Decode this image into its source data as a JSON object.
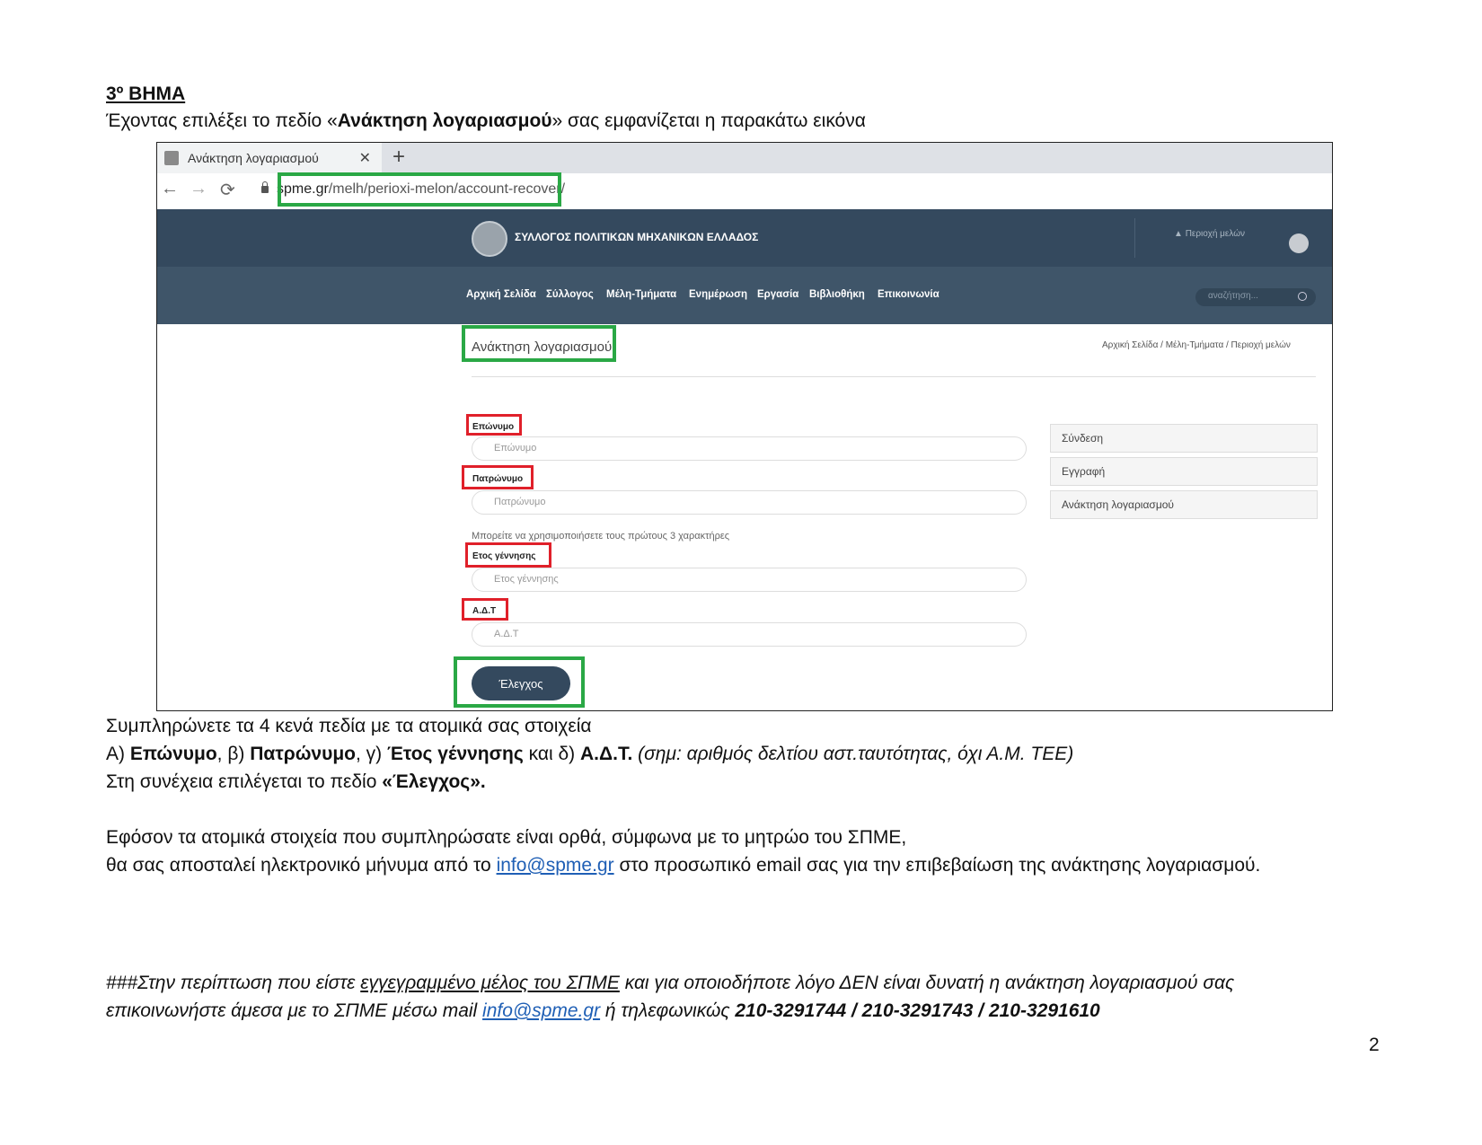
{
  "doc": {
    "step_title": "3º ΒΗΜΑ",
    "intro_pre": "Έχοντας επιλέξει το πεδίο «",
    "intro_bold": "Ανάκτηση λογαριασμού",
    "intro_post": "» σας εμφανίζεται η παρακάτω εικόνα",
    "fill_line": "Συμπληρώνετε τα 4 κενά πεδία με τα ατομικά σας στοιχεία",
    "fields_line": {
      "p1": "Α) ",
      "b1": "Επώνυμο",
      "p2": ", β) ",
      "b2": "Πατρώνυμο",
      "p3": ", γ) ",
      "b3": "Έτος γέννησης",
      "p4": " και δ) ",
      "b4": "Α.Δ.Τ.",
      "note": " (σημ: αριθμός δελτίου αστ.ταυτότητας, όχι Α.Μ. ΤΕΕ)"
    },
    "then_pre": "Στη συνέχεια επιλέγεται το πεδίο ",
    "then_bold": "«Έλεγχος».",
    "info_line1": "Εφόσον τα ατομικά στοιχεία που συμπληρώσατε είναι ορθά, σύμφωνα με το μητρώο του ΣΠΜΕ,",
    "info_line2_pre": "θα σας αποσταλεί ηλεκτρονικό μήνυμα από το ",
    "info_email": "info@spme.gr",
    "info_line2_post": " στο προσωπικό email σας για την επιβεβαίωση της ανάκτησης λογαριασμού.",
    "footer_pre": "###Στην περίπτωση που είστε ",
    "footer_u": "εγγεγραμμένο μέλος του ΣΠΜΕ",
    "footer_post": " και για οποιοδήποτε λόγο ΔΕΝ είναι δυνατή η ανάκτηση λογαριασμού σας",
    "footer2_pre": "επικοινωνήστε άμεσα με το ΣΠΜΕ μέσω mail  ",
    "footer2_email": "info@spme.gr",
    "footer2_mid": " ή τηλεφωνικώς ",
    "footer2_phones": "210-3291744 / 210-3291743 / 210-3291610",
    "page_number": "2"
  },
  "browser": {
    "tab_title": "Ανάκτηση λογαριασμού",
    "tab_close": "✕",
    "new_tab": "+",
    "url_host": "spme.gr",
    "url_path": "/melh/perioxi-melon/account-recover/"
  },
  "site": {
    "name": "ΣΥΛΛΟΓΟΣ ΠΟΛΙΤΙΚΩΝ ΜΗΧΑΝΙΚΩΝ ΕΛΛΑΔΟΣ",
    "member_area": "Περιοχή μελών",
    "nav": [
      "Αρχική Σελίδα",
      "Σύλλογος",
      "Μέλη-Τμήματα",
      "Ενημέρωση",
      "Εργασία",
      "Βιβλιοθήκη",
      "Επικοινωνία"
    ],
    "search_placeholder": "αναζήτηση...",
    "page_title": "Ανάκτηση λογαριασμού",
    "breadcrumb": "Αρχική Σελίδα  /  Μέλη-Τμήματα  /  Περιοχή μελών",
    "form": {
      "surname_label": "Επώνυμο",
      "surname_placeholder": "Επώνυμο",
      "father_label": "Πατρώνυμο",
      "father_placeholder": "Πατρώνυμο",
      "hint": "Μπορείτε να χρησιμοποιήσετε τους πρώτους 3 χαρακτήρες",
      "birth_label": "Ετος γέννησης",
      "birth_placeholder": "Ετος γέννησης",
      "id_label": "Α.Δ.Τ",
      "id_placeholder": "Α.Δ.Τ",
      "submit": "Έλεγχος"
    },
    "sidebar": [
      "Σύνδεση",
      "Εγγραφή",
      "Ανάκτηση λογαριασμού"
    ]
  }
}
